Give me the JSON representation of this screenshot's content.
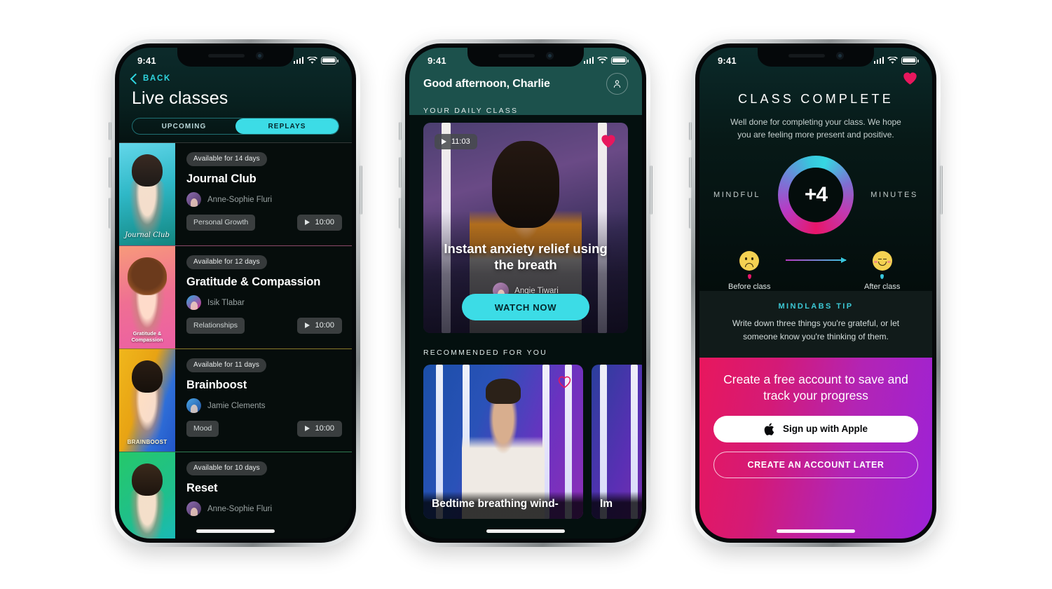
{
  "statusbar": {
    "time": "9:41"
  },
  "phone1": {
    "back_label": "BACK",
    "title": "Live classes",
    "tabs": [
      {
        "label": "UPCOMING",
        "active": false
      },
      {
        "label": "REPLAYS",
        "active": true
      }
    ],
    "classes": [
      {
        "availability": "Available for 14 days",
        "title": "Journal Club",
        "teacher": "Anne-Sophie Fluri",
        "category": "Personal Growth",
        "duration": "10:00",
        "thumb_caption": "Journal Club"
      },
      {
        "availability": "Available for 12 days",
        "title": "Gratitude & Compassion",
        "teacher": "Isik Tlabar",
        "category": "Relationships",
        "duration": "10:00",
        "thumb_caption": "Gratitude & Compassion"
      },
      {
        "availability": "Available for 11 days",
        "title": "Brainboost",
        "teacher": "Jamie Clements",
        "category": "Mood",
        "duration": "10:00",
        "thumb_caption": "BRAINBOOST"
      },
      {
        "availability": "Available for 10 days",
        "title": "Reset",
        "teacher": "Anne-Sophie Fluri",
        "category": "",
        "duration": "",
        "thumb_caption": ""
      }
    ]
  },
  "phone2": {
    "greeting": "Good afternoon, Charlie",
    "section_daily": "YOUR DAILY CLASS",
    "hero": {
      "duration": "11:03",
      "title": "Instant anxiety relief using the breath",
      "teacher": "Angie Tiwari",
      "cta": "WATCH NOW"
    },
    "section_recommended": "RECOMMENDED FOR YOU",
    "recommended": [
      {
        "title": "Bedtime breathing wind-"
      },
      {
        "title": "Im"
      }
    ]
  },
  "phone3": {
    "title": "CLASS COMPLETE",
    "subtitle": "Well done for completing your class. We hope you are feeling more present and positive.",
    "stat": {
      "left_label": "MINDFUL",
      "value": "+4",
      "right_label": "MINUTES"
    },
    "mood": {
      "before_label": "Before class",
      "after_label": "After class"
    },
    "tip": {
      "heading": "MINDLABS TIP",
      "body": "Write down three things you're grateful, or let someone know you're thinking of them."
    },
    "cta": {
      "title": "Create a free account to save and track your progress",
      "apple_label": "Sign up with Apple",
      "later_label": "CREATE AN ACCOUNT LATER"
    }
  },
  "colors": {
    "accent_cyan": "#3cdce6",
    "accent_pink": "#e8175d",
    "accent_purple": "#9c22d8",
    "teal_header": "#1c514c"
  }
}
